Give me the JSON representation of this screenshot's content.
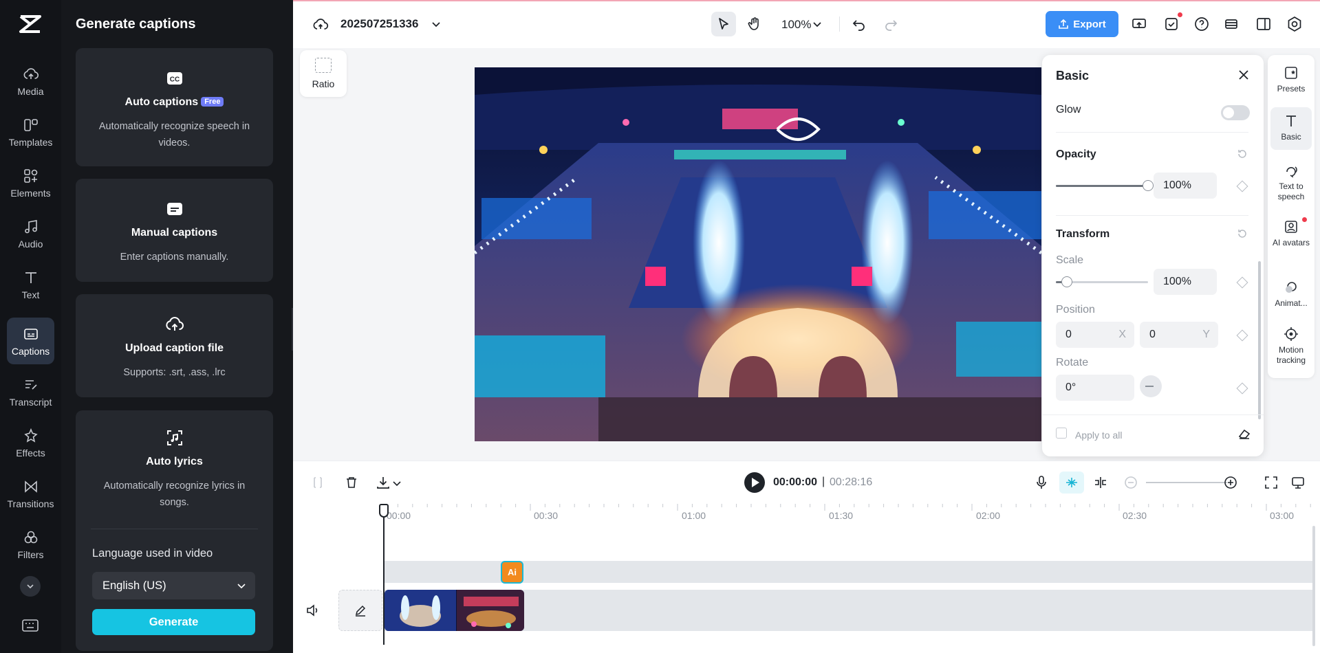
{
  "rail": {
    "logo": "capcut-logo-icon",
    "items": [
      {
        "label": "Media",
        "icon": "cloud-upload-icon"
      },
      {
        "label": "Templates",
        "icon": "templates-icon"
      },
      {
        "label": "Elements",
        "icon": "elements-icon"
      },
      {
        "label": "Audio",
        "icon": "music-note-icon"
      },
      {
        "label": "Text",
        "icon": "text-t-icon"
      },
      {
        "label": "Captions",
        "icon": "captions-icon",
        "active": true
      },
      {
        "label": "Transcript",
        "icon": "transcript-icon"
      },
      {
        "label": "Effects",
        "icon": "sparkle-icon"
      },
      {
        "label": "Transitions",
        "icon": "transition-icon"
      },
      {
        "label": "Filters",
        "icon": "filters-icon"
      }
    ]
  },
  "panel": {
    "title": "Generate captions",
    "cards": [
      {
        "title": "Auto captions",
        "badge": "Free",
        "desc": "Automatically recognize speech in videos.",
        "icon": "cc-icon"
      },
      {
        "title": "Manual captions",
        "desc": "Enter captions manually.",
        "icon": "subtitle-icon"
      },
      {
        "title": "Upload caption file",
        "desc": "Supports: .srt, .ass, .lrc",
        "icon": "cloud-upload-icon"
      },
      {
        "title": "Auto lyrics",
        "desc": "Automatically recognize lyrics in songs.",
        "icon": "lyrics-icon"
      }
    ],
    "language_label": "Language used in video",
    "language_value": "English (US)",
    "generate_label": "Generate"
  },
  "topbar": {
    "project_name": "202507251336",
    "zoom": "100%",
    "export_label": "Export"
  },
  "canvas": {
    "ratio_label": "Ratio"
  },
  "props": {
    "title": "Basic",
    "glow_label": "Glow",
    "glow_on": false,
    "opacity_label": "Opacity",
    "opacity_value": "100%",
    "opacity_fraction": 1.0,
    "transform_label": "Transform",
    "scale_label": "Scale",
    "scale_value": "100%",
    "scale_fraction": 0.12,
    "position_label": "Position",
    "position_x": "0",
    "position_y": "0",
    "axis_x": "X",
    "axis_y": "Y",
    "rotate_label": "Rotate",
    "rotate_value": "0°",
    "apply_all_label": "Apply to all"
  },
  "right_rail": [
    {
      "label": "Presets",
      "icon": "presets-icon"
    },
    {
      "label": "Basic",
      "icon": "text-t-icon",
      "active": true
    },
    {
      "label": "Text to speech",
      "icon": "speech-icon"
    },
    {
      "label": "AI avatars",
      "icon": "avatar-icon"
    },
    {
      "label": "Animat...",
      "icon": "animation-icon"
    },
    {
      "label": "Motion tracking",
      "icon": "target-icon"
    }
  ],
  "timeline": {
    "current_time": "00:00:00",
    "separator": "|",
    "total_time": "00:28:16",
    "ticks": [
      "00:00",
      "00:30",
      "01:00",
      "01:30",
      "02:00",
      "02:30",
      "03:00"
    ],
    "caption_chip": "Ai"
  },
  "colors": {
    "accent": "#16c4e2",
    "export": "#3a8ef6",
    "rail_bg": "#121418",
    "panel_bg": "#16181c"
  }
}
